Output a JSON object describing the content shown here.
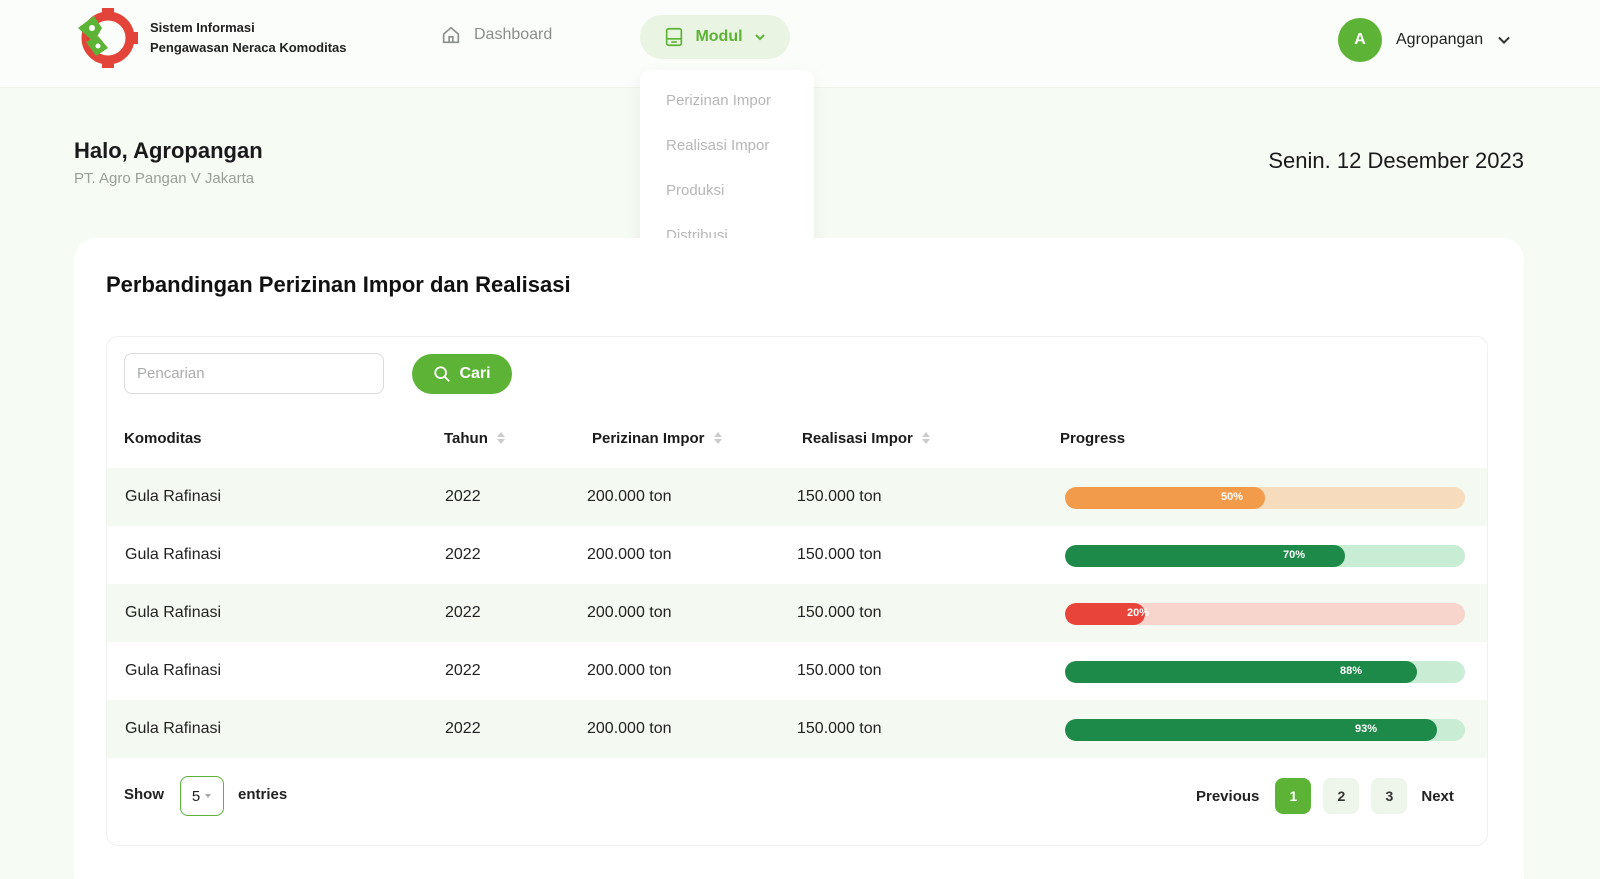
{
  "header": {
    "brand_line1": "Sistem Informasi",
    "brand_line2": "Pengawasan Neraca Komoditas",
    "nav_dashboard": "Dashboard",
    "nav_modul": "Modul",
    "modul_menu": [
      "Perizinan Impor",
      "Realisasi Impor",
      "Produksi",
      "Distribusi"
    ],
    "user_initial": "A",
    "user_name": "Agropangan"
  },
  "greeting": {
    "title": "Halo, Agropangan",
    "subtitle": "PT. Agro Pangan V Jakarta",
    "date": "Senin. 12 Desember 2023"
  },
  "card": {
    "title": "Perbandingan Perizinan Impor dan Realisasi",
    "search_placeholder": "Pencarian",
    "search_button": "Cari",
    "columns": [
      "Komoditas",
      "Tahun",
      "Perizinan Impor",
      "Realisasi Impor",
      "Progress"
    ],
    "rows": [
      {
        "komoditas": "Gula Rafinasi",
        "tahun": "2022",
        "perizinan": "200.000 ton",
        "realisasi": "150.000 ton",
        "progress": 50,
        "progress_label": "50%",
        "color": "#f29b4a",
        "track": "#f6dcbc"
      },
      {
        "komoditas": "Gula Rafinasi",
        "tahun": "2022",
        "perizinan": "200.000 ton",
        "realisasi": "150.000 ton",
        "progress": 70,
        "progress_label": "70%",
        "color": "#1e8a4a",
        "track": "#c8ecd4"
      },
      {
        "komoditas": "Gula Rafinasi",
        "tahun": "2022",
        "perizinan": "200.000 ton",
        "realisasi": "150.000 ton",
        "progress": 20,
        "progress_label": "20%",
        "color": "#e8443a",
        "track": "#f7d4cc"
      },
      {
        "komoditas": "Gula Rafinasi",
        "tahun": "2022",
        "perizinan": "200.000 ton",
        "realisasi": "150.000 ton",
        "progress": 88,
        "progress_label": "88%",
        "color": "#1e8a4a",
        "track": "#c8ecd4"
      },
      {
        "komoditas": "Gula Rafinasi",
        "tahun": "2022",
        "perizinan": "200.000 ton",
        "realisasi": "150.000 ton",
        "progress": 93,
        "progress_label": "93%",
        "color": "#1e8a4a",
        "track": "#c8ecd4"
      }
    ]
  },
  "footer": {
    "show_label": "Show",
    "entries_value": "5",
    "entries_label": "entries",
    "previous": "Previous",
    "pages": [
      "1",
      "2",
      "3"
    ],
    "active_page": "1",
    "next": "Next"
  }
}
